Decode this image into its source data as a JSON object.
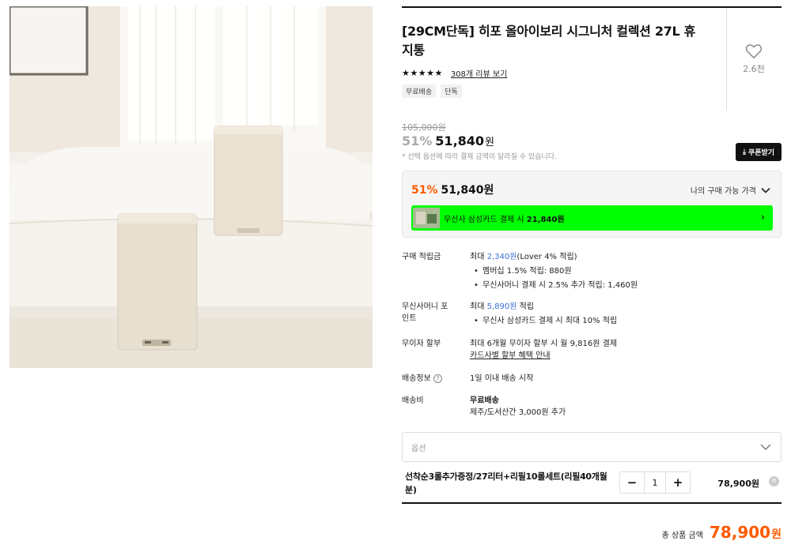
{
  "product": {
    "title": "[29CM단독] 히포 올아이보리 시그니처 컬렉션 27L 휴지통",
    "like_count": "2.6천",
    "stars": "★★★★★",
    "review_link": "308개 리뷰 보기",
    "tags": [
      "무료배송",
      "단독"
    ]
  },
  "price": {
    "original": "105,000원",
    "discount": "51%",
    "amount": "51,840",
    "won": "원",
    "note": "* 선택 옵션에 따라 결제 금액이 달라질 수 있습니다.",
    "coupon_label": "쿠폰받기"
  },
  "price_box": {
    "discount": "51%",
    "amount": "51,840원",
    "label": "나의 구매 가능 가격",
    "card_text": "무신사 삼성카드 결제 시",
    "card_amount": "21,840원"
  },
  "info": {
    "points": {
      "label": "구매 적립금",
      "prefix": "최대 ",
      "highlight": "2,340원",
      "suffix": "(Lover 4% 적립)",
      "sub1": "멤버십 1.5% 적립: 880원",
      "sub2": "무신사머니 결제 시 2.5% 추가 적립: 1,460원"
    },
    "money": {
      "label": "무신사머니 포인트",
      "prefix": "최대 ",
      "highlight": "5,890원",
      "suffix": " 적립",
      "sub1": "무신사 삼성카드 결제 시 최대 10% 적립"
    },
    "installment": {
      "label": "무이자 할부",
      "line1": "최대 6개월 무이자 할부 시 월 9,816원 결제",
      "link": "카드사별 할부 혜택 안내"
    },
    "shipping": {
      "label": "배송정보",
      "help": "?",
      "value": "1일 이내 배송 시작"
    },
    "fee": {
      "label": "배송비",
      "line1": "무료배송",
      "line2": "제주/도서산간 3,000원 추가"
    }
  },
  "option": {
    "placeholder": "옵션"
  },
  "selected_item": {
    "name": "선착순3롤추가증정/27리터+리필10롤세트(리필40개월분)",
    "qty": "1",
    "minus": "−",
    "plus": "+",
    "price": "78,900원",
    "remove": "×"
  },
  "total": {
    "label": "총 상품 금액",
    "amount": "78,900",
    "won": "원"
  },
  "colors": {
    "accent": "#ff5a00",
    "card_banner": "#00ff00",
    "link_blue": "#3b6fd8"
  }
}
